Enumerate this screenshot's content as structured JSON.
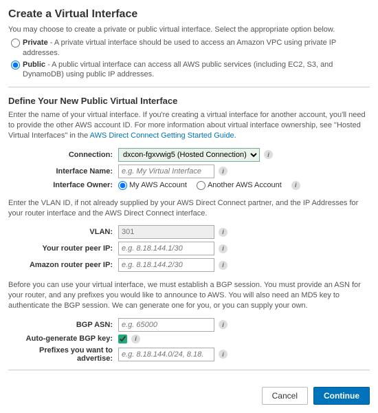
{
  "title": "Create a Virtual Interface",
  "intro": "You may choose to create a private or public virtual interface. Select the appropriate option below.",
  "type_options": {
    "private": {
      "label": "Private",
      "desc": " - A private virtual interface should be used to access an Amazon VPC using private IP addresses."
    },
    "public": {
      "label": "Public",
      "desc": " - A public virtual interface can access all AWS public services (including EC2, S3, and DynamoDB) using public IP addresses."
    }
  },
  "define": {
    "heading": "Define Your New Public Virtual Interface",
    "desc_pre": "Enter the name of your virtual interface. If you're creating a virtual interface for another account, you'll need to provide the other AWS account ID. For more information about virtual interface ownership, see \"Hosted Virtual Interfaces\" in the ",
    "link": "AWS Direct Connect Getting Started Guide",
    "desc_post": ".",
    "connection_label": "Connection:",
    "connection_value": "dxcon-fgxvwig5 (Hosted Connection)",
    "interface_name_label": "Interface Name:",
    "interface_name_placeholder": "e.g. My Virtual Interface",
    "owner_label": "Interface Owner:",
    "owner_my": "My AWS Account",
    "owner_other": "Another AWS Account"
  },
  "vlan": {
    "desc": "Enter the VLAN ID, if not already supplied by your AWS Direct Connect partner, and the IP Addresses for your router interface and the AWS Direct Connect interface.",
    "vlan_label": "VLAN:",
    "vlan_value": "301",
    "your_peer_label": "Your router peer IP:",
    "your_peer_placeholder": "e.g. 8.18.144.1/30",
    "amazon_peer_label": "Amazon router peer IP:",
    "amazon_peer_placeholder": "e.g. 8.18.144.2/30"
  },
  "bgp": {
    "desc": "Before you can use your virtual interface, we must establish a BGP session. You must provide an ASN for your router, and any prefixes you would like to announce to AWS. You will also need an MD5 key to authenticate the BGP session. We can generate one for you, or you can supply your own.",
    "asn_label": "BGP ASN:",
    "asn_placeholder": "e.g. 65000",
    "auto_key_label": "Auto-generate BGP key:",
    "prefixes_label": "Prefixes you want to advertise:",
    "prefixes_placeholder": "e.g. 8.18.144.0/24, 8.18."
  },
  "info_glyph": "i",
  "actions": {
    "cancel": "Cancel",
    "continue": "Continue"
  }
}
